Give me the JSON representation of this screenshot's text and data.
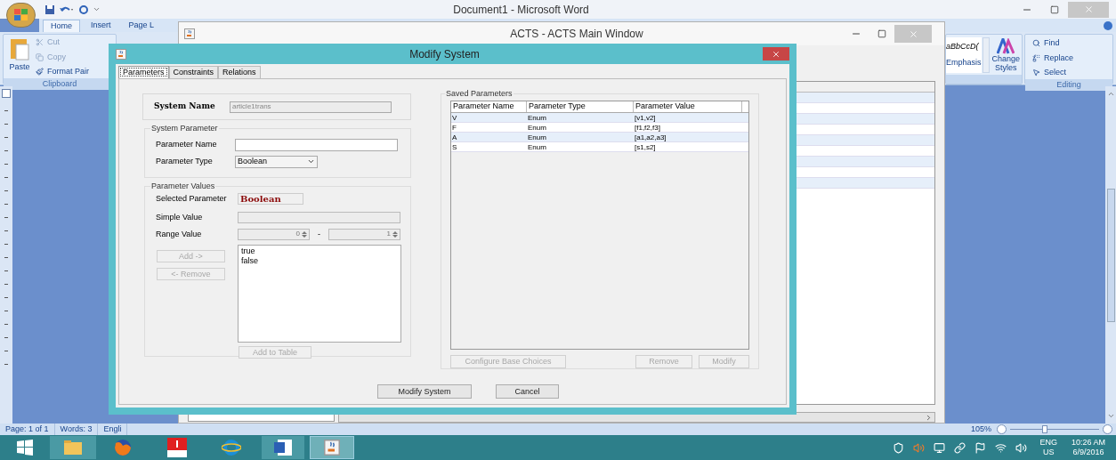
{
  "word": {
    "title": "Document1 - Microsoft Word",
    "ribbon_tabs": [
      {
        "label": "Home",
        "selected": true
      },
      {
        "label": "Insert",
        "selected": false
      },
      {
        "label": "Page L",
        "selected": false
      }
    ],
    "clipboard": {
      "paste": "Paste",
      "items": [
        "Cut",
        "Copy",
        "Format Pair"
      ],
      "group": "Clipboard"
    },
    "styles": {
      "preview": "aBbCcD(",
      "name": "Emphasis",
      "change": "Change Styles"
    },
    "editing": {
      "items": [
        "Find",
        "Replace",
        "Select"
      ],
      "group": "Editing"
    },
    "status_bar": {
      "items": [
        "Page: 1 of 1",
        "Words: 3",
        "Engli"
      ],
      "zoom": "105%",
      "level": 0.38
    }
  },
  "acts_window": {
    "title": "ACTS - ACTS Main Window"
  },
  "dialog": {
    "title": "Modify System",
    "tabs": [
      {
        "label": "Parameters",
        "selected": true
      },
      {
        "label": "Constraints",
        "selected": false
      },
      {
        "label": "Relations",
        "selected": false
      }
    ],
    "system_name": {
      "label": "System Name",
      "value": "article1trans"
    },
    "system_parameter": {
      "title": "System Parameter",
      "name_label": "Parameter Name",
      "type_label": "Parameter Type",
      "type_value": "Boolean"
    },
    "parameter_values": {
      "title": "Parameter Values",
      "selected_label": "Selected Parameter",
      "selected_value": "Boolean",
      "simple_label": "Simple Value",
      "range_label": "Range Value",
      "range_from": "0",
      "range_separator": "-",
      "range_to": "1",
      "side_buttons": [
        {
          "label": "Add ->",
          "disabled": true
        },
        {
          "label": "<- Remove",
          "disabled": true
        }
      ],
      "values": [
        "true",
        "false"
      ],
      "add_to_table": {
        "label": "Add to Table",
        "disabled": true
      }
    },
    "saved": {
      "title": "Saved Parameters",
      "columns": [
        "Parameter Name",
        "Parameter Type",
        "Parameter Value"
      ],
      "rows": [
        [
          "V",
          "Enum",
          "[v1,v2]"
        ],
        [
          "F",
          "Enum",
          "[f1,f2,f3]"
        ],
        [
          "A",
          "Enum",
          "[a1,a2,a3]"
        ],
        [
          "S",
          "Enum",
          "[s1,s2]"
        ]
      ],
      "buttons": [
        {
          "label": "Configure Base Choices",
          "disabled": true
        },
        {
          "label": "Remove",
          "disabled": true
        },
        {
          "label": "Modify",
          "disabled": true
        }
      ]
    },
    "buttons": [
      {
        "label": "Modify System",
        "disabled": false
      },
      {
        "label": "Cancel",
        "disabled": false
      }
    ]
  },
  "taskbar": {
    "lang": "ENG",
    "region": "US",
    "time": "10:26 AM",
    "date": "6/9/2016"
  }
}
